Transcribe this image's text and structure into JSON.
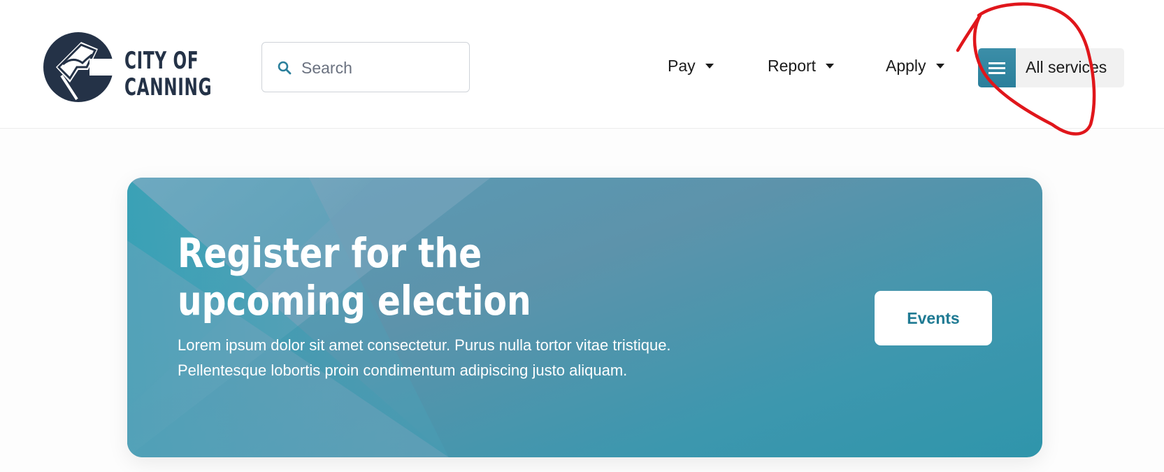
{
  "header": {
    "logo": {
      "line1": "CITY OF",
      "line2": "CANNING"
    },
    "search": {
      "placeholder": "Search",
      "value": "",
      "icon": "search-icon"
    },
    "nav": [
      {
        "label": "Pay",
        "icon": "caret-down-icon"
      },
      {
        "label": "Report",
        "icon": "caret-down-icon"
      },
      {
        "label": "Apply",
        "icon": "caret-down-icon"
      }
    ],
    "all_services": {
      "label": "All services",
      "icon": "hamburger-menu-icon"
    }
  },
  "banner": {
    "title": "Register for the upcoming election",
    "body": "Lorem ipsum dolor sit amet consectetur. Purus nulla tortor vitae tristique. Pellentesque lobortis proin condimentum adipiscing justo aliquam.",
    "cta_label": "Events"
  },
  "colors": {
    "brand_navy": "#243247",
    "accent_teal": "#2a7f9b",
    "annotation_red": "#e0161b"
  }
}
